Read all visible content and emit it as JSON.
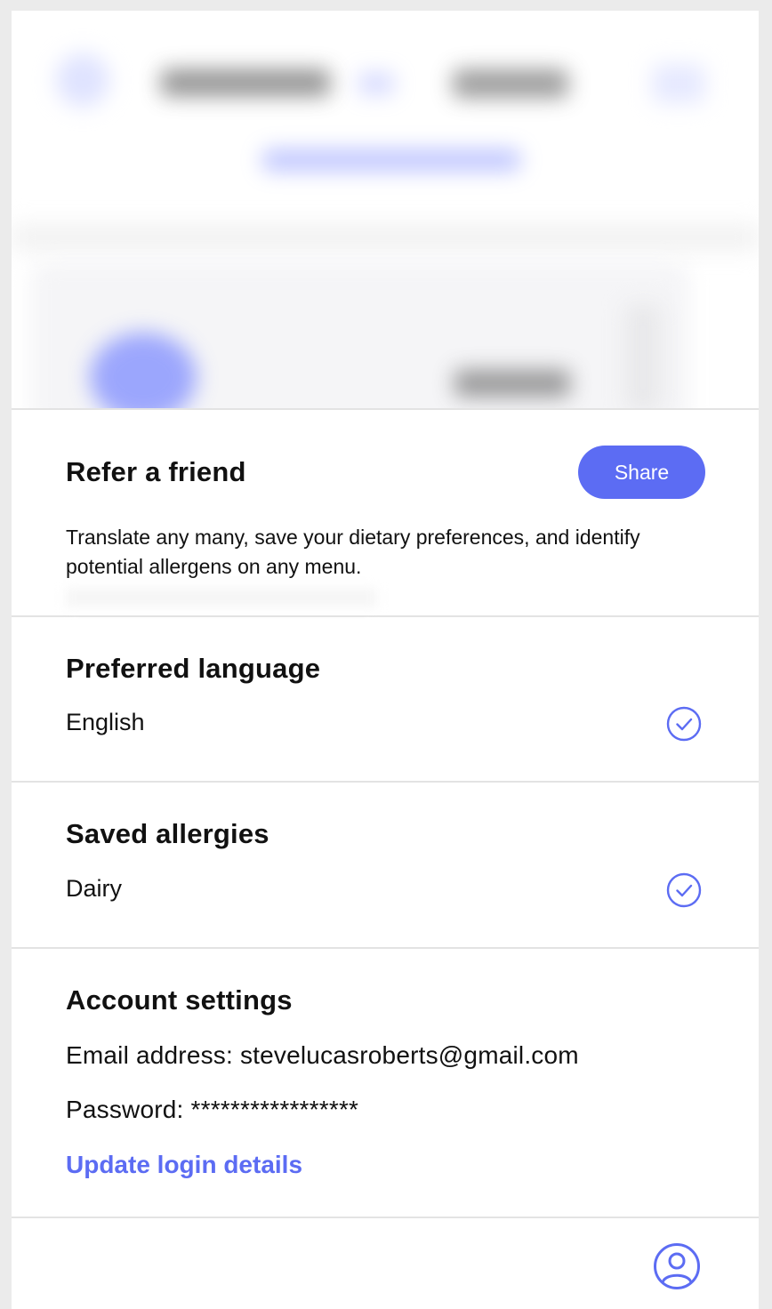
{
  "refer": {
    "title": "Refer a friend",
    "share_label": "Share",
    "description": "Translate any many, save your dietary preferences, and identify potential allergens on any menu."
  },
  "language": {
    "title": "Preferred language",
    "value": "English",
    "icon": "check-circle-icon"
  },
  "allergies": {
    "title": "Saved allergies",
    "value": "Dairy",
    "icon": "check-circle-icon"
  },
  "account": {
    "title": "Account settings",
    "email_line": "Email address: stevelucasroberts@gmail.com",
    "password_line": "Password: *****************",
    "update_link": "Update login details"
  },
  "bottom_nav": {
    "icon": "profile-icon"
  },
  "colors": {
    "accent": "#5c6cf3",
    "divider": "#e3e3e3",
    "background": "#ebebeb"
  }
}
